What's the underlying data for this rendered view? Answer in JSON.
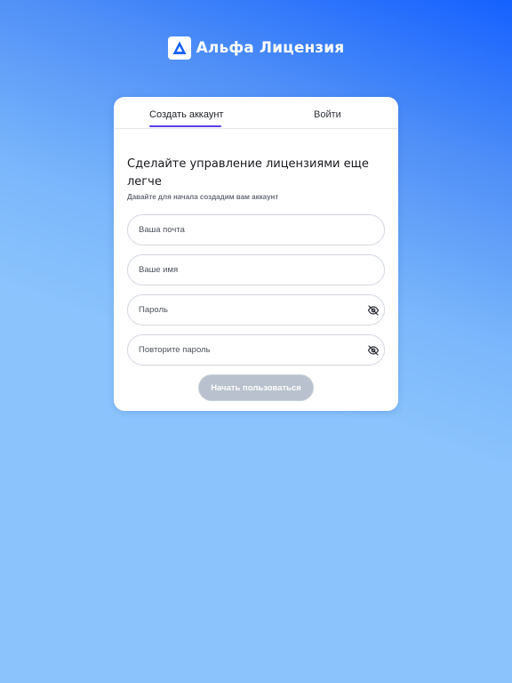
{
  "brand": {
    "logo_icon": "triangle-a-logo-icon",
    "name": "Альфа Лицензия"
  },
  "tabs": [
    {
      "label": "Создать аккаунт",
      "active": true
    },
    {
      "label": "Войти",
      "active": false
    }
  ],
  "form": {
    "heading": "Сделайте управление лицензиями еще легче",
    "subheading": "Давайте для начала создадим вам аккаунт",
    "fields": {
      "email": {
        "placeholder": "Ваша почта",
        "value": ""
      },
      "name": {
        "placeholder": "Ваше имя",
        "value": ""
      },
      "password": {
        "placeholder": "Пароль",
        "value": "",
        "toggle_icon": "eye-off-icon"
      },
      "password_repeat": {
        "placeholder": "Повторите пароль",
        "value": "",
        "toggle_icon": "eye-off-icon"
      }
    },
    "submit_label": "Начать пользоваться",
    "submit_enabled": false
  },
  "colors": {
    "accent": "#5a3fe6",
    "brand_blue": "#1561ff",
    "background": "#8bc4fd",
    "disabled_button": "#b8c1cd"
  }
}
